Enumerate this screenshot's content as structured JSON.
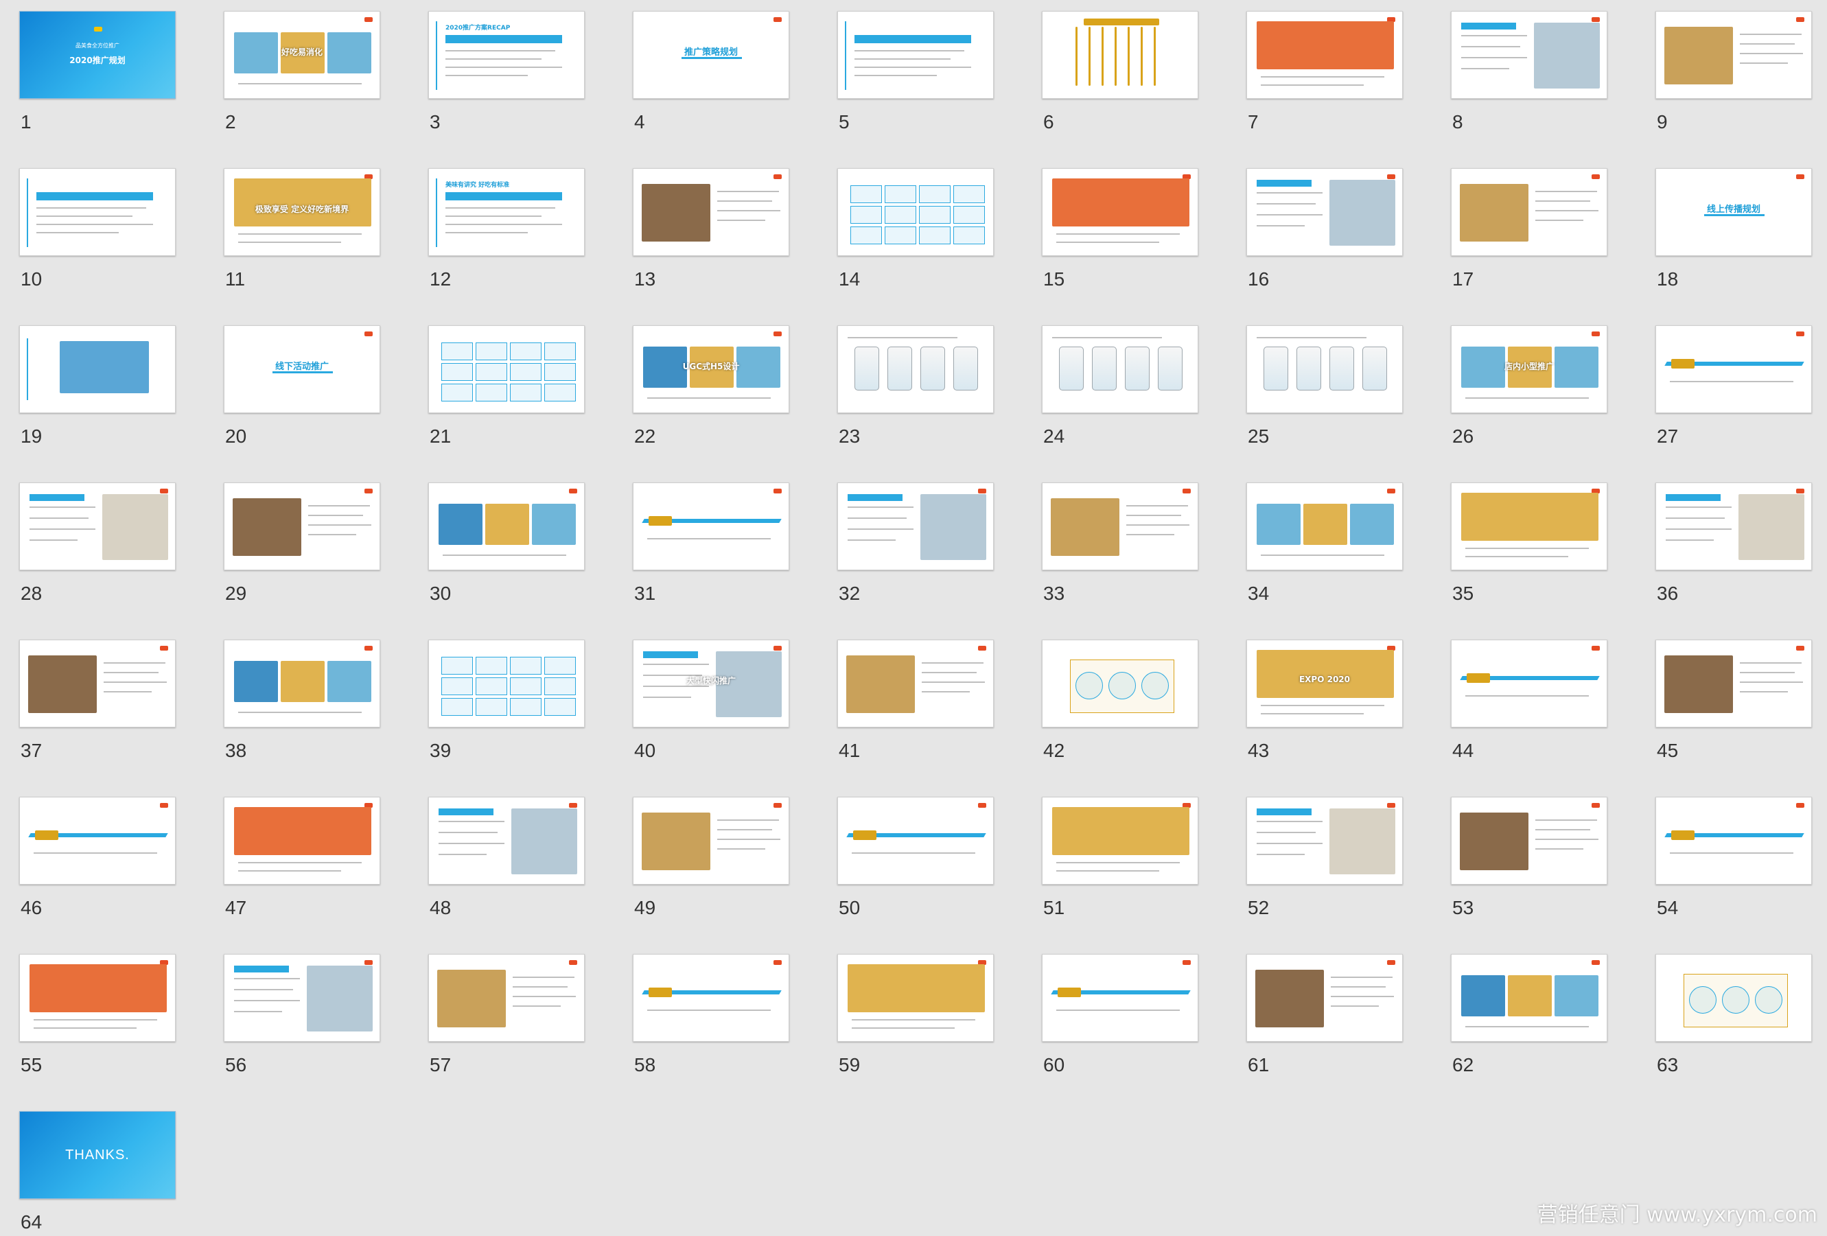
{
  "window": {
    "view": "slide-sorter",
    "background": "#e6e6e6",
    "accent": "#2aa9e0"
  },
  "slides": [
    {
      "n": "1",
      "style": "cover",
      "title": "2020推广规划",
      "subtitle": "品美食全方位推广"
    },
    {
      "n": "2",
      "style": "image",
      "title": "好吃易消化"
    },
    {
      "n": "3",
      "style": "text",
      "title": "2020推广方案RECAP"
    },
    {
      "n": "4",
      "style": "title",
      "title": "推广策略规划"
    },
    {
      "n": "5",
      "style": "text",
      "title": ""
    },
    {
      "n": "6",
      "style": "columns",
      "title": ""
    },
    {
      "n": "7",
      "style": "image",
      "title": ""
    },
    {
      "n": "8",
      "style": "image",
      "title": ""
    },
    {
      "n": "9",
      "style": "image",
      "title": ""
    },
    {
      "n": "10",
      "style": "text",
      "title": ""
    },
    {
      "n": "11",
      "style": "image",
      "title": "极致享受 定义好吃新境界"
    },
    {
      "n": "12",
      "style": "text",
      "title": "美味有讲究 好吃有标准"
    },
    {
      "n": "13",
      "style": "image",
      "title": ""
    },
    {
      "n": "14",
      "style": "table",
      "title": ""
    },
    {
      "n": "15",
      "style": "image",
      "title": ""
    },
    {
      "n": "16",
      "style": "image",
      "title": ""
    },
    {
      "n": "17",
      "style": "image",
      "title": ""
    },
    {
      "n": "18",
      "style": "title",
      "title": "线上传播规划"
    },
    {
      "n": "19",
      "style": "block",
      "title": ""
    },
    {
      "n": "20",
      "style": "title",
      "title": "线下活动推广"
    },
    {
      "n": "21",
      "style": "table",
      "title": ""
    },
    {
      "n": "22",
      "style": "image",
      "title": "UGC式H5设计"
    },
    {
      "n": "23",
      "style": "phones",
      "title": ""
    },
    {
      "n": "24",
      "style": "phones",
      "title": ""
    },
    {
      "n": "25",
      "style": "phones",
      "title": ""
    },
    {
      "n": "26",
      "style": "image",
      "title": "店内小型推广"
    },
    {
      "n": "27",
      "style": "bar",
      "title": ""
    },
    {
      "n": "28",
      "style": "image",
      "title": ""
    },
    {
      "n": "29",
      "style": "image",
      "title": ""
    },
    {
      "n": "30",
      "style": "image",
      "title": ""
    },
    {
      "n": "31",
      "style": "bar",
      "title": ""
    },
    {
      "n": "32",
      "style": "image",
      "title": ""
    },
    {
      "n": "33",
      "style": "image",
      "title": ""
    },
    {
      "n": "34",
      "style": "image",
      "title": ""
    },
    {
      "n": "35",
      "style": "image",
      "title": ""
    },
    {
      "n": "36",
      "style": "image",
      "title": ""
    },
    {
      "n": "37",
      "style": "image",
      "title": ""
    },
    {
      "n": "38",
      "style": "image",
      "title": ""
    },
    {
      "n": "39",
      "style": "table",
      "title": ""
    },
    {
      "n": "40",
      "style": "image",
      "title": "大型快闪推广"
    },
    {
      "n": "41",
      "style": "image",
      "title": ""
    },
    {
      "n": "42",
      "style": "diagram",
      "title": ""
    },
    {
      "n": "43",
      "style": "image",
      "title": "EXPO 2020"
    },
    {
      "n": "44",
      "style": "bar",
      "title": ""
    },
    {
      "n": "45",
      "style": "image",
      "title": ""
    },
    {
      "n": "46",
      "style": "bar",
      "title": ""
    },
    {
      "n": "47",
      "style": "image",
      "title": ""
    },
    {
      "n": "48",
      "style": "image",
      "title": ""
    },
    {
      "n": "49",
      "style": "image",
      "title": ""
    },
    {
      "n": "50",
      "style": "bar",
      "title": ""
    },
    {
      "n": "51",
      "style": "image",
      "title": ""
    },
    {
      "n": "52",
      "style": "image",
      "title": ""
    },
    {
      "n": "53",
      "style": "image",
      "title": ""
    },
    {
      "n": "54",
      "style": "bar",
      "title": ""
    },
    {
      "n": "55",
      "style": "image",
      "title": ""
    },
    {
      "n": "56",
      "style": "image",
      "title": ""
    },
    {
      "n": "57",
      "style": "image",
      "title": ""
    },
    {
      "n": "58",
      "style": "bar",
      "title": ""
    },
    {
      "n": "59",
      "style": "image",
      "title": ""
    },
    {
      "n": "60",
      "style": "bar",
      "title": ""
    },
    {
      "n": "61",
      "style": "image",
      "title": ""
    },
    {
      "n": "62",
      "style": "image",
      "title": ""
    },
    {
      "n": "63",
      "style": "diagram",
      "title": ""
    },
    {
      "n": "64",
      "style": "thanks",
      "title": "THANKS."
    }
  ],
  "watermark": "营销任意门 www.yxrym.com"
}
